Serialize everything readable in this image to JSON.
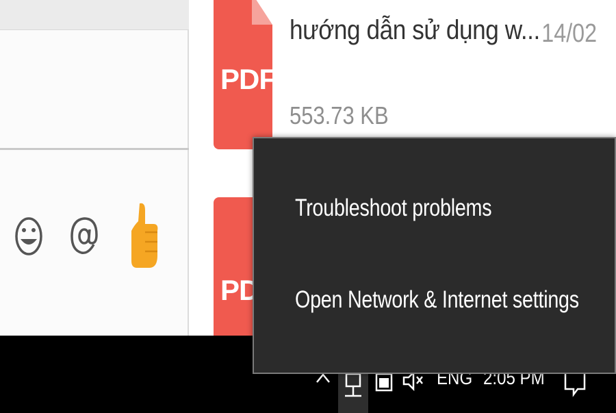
{
  "chat_panel": {
    "toolbar": {
      "emoji_icon": "smiley-face",
      "mention_icon": "at-sign",
      "like_icon": "thumbs-up"
    }
  },
  "file_list": {
    "items": [
      {
        "type_label": "PDF",
        "name": "hướng dẫn sử dụng w...",
        "date": "14/02",
        "size": "553.73 KB"
      },
      {
        "type_label": "PDF"
      }
    ]
  },
  "context_menu": {
    "items": [
      {
        "label": "Troubleshoot problems"
      },
      {
        "label": "Open Network & Internet settings"
      }
    ]
  },
  "taskbar": {
    "language": "ENG",
    "time": "2:05 PM"
  },
  "colors": {
    "pdf_red": "#f05a4f",
    "menu_bg": "#2b2b2b",
    "taskbar_bg": "#000000",
    "thumb_yellow": "#f5a623"
  }
}
